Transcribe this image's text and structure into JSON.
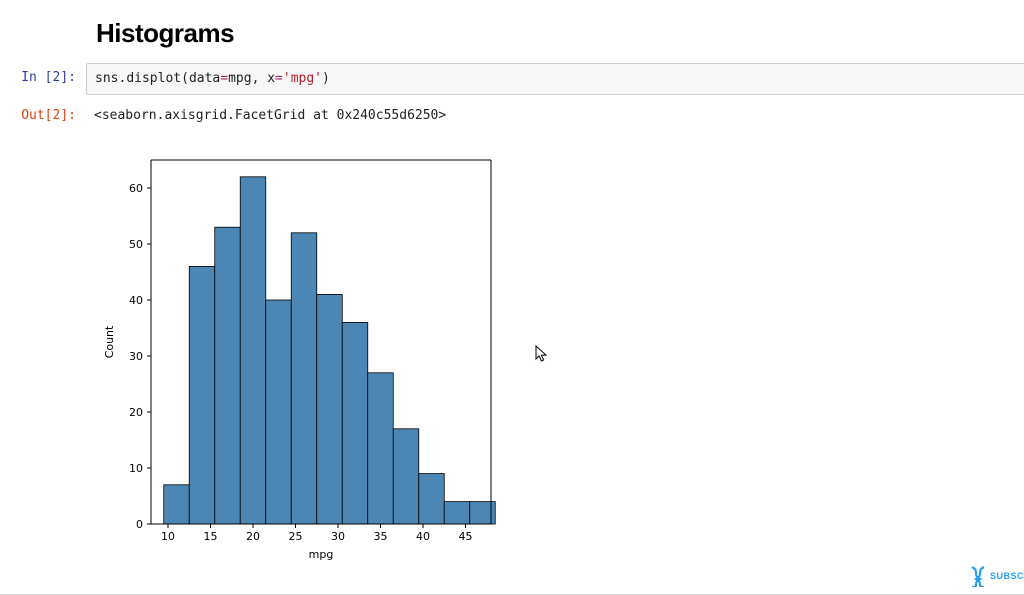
{
  "heading": "Histograms",
  "input_cell": {
    "prompt": "In [2]:",
    "code_tokens": [
      {
        "t": "sns",
        "c": "tok-ident"
      },
      {
        "t": ".",
        "c": "tok-punc"
      },
      {
        "t": "displot",
        "c": "tok-ident"
      },
      {
        "t": "(",
        "c": "tok-punc"
      },
      {
        "t": "data",
        "c": "tok-ident"
      },
      {
        "t": "=",
        "c": "tok-op"
      },
      {
        "t": "mpg",
        "c": "tok-ident"
      },
      {
        "t": ", ",
        "c": "tok-punc"
      },
      {
        "t": "x",
        "c": "tok-ident"
      },
      {
        "t": "=",
        "c": "tok-op"
      },
      {
        "t": "'mpg'",
        "c": "tok-str"
      },
      {
        "t": ")",
        "c": "tok-punc"
      }
    ]
  },
  "output_cell": {
    "prompt": "Out[2]:",
    "text": "<seaborn.axisgrid.FacetGrid at 0x240c55d6250>"
  },
  "watermark": "SUBSC",
  "chart_data": {
    "type": "bar",
    "title": "",
    "xlabel": "mpg",
    "ylabel": "Count",
    "xlim": [
      8,
      48
    ],
    "ylim": [
      0,
      65
    ],
    "xticks": [
      10,
      15,
      20,
      25,
      30,
      35,
      40,
      45
    ],
    "yticks": [
      0,
      10,
      20,
      30,
      40,
      50,
      60
    ],
    "bin_width": 3,
    "bin_left_edges": [
      9.5,
      12.5,
      15.5,
      18.5,
      21.5,
      24.5,
      27.5,
      30.5,
      33.5,
      36.5,
      39.5,
      42.5,
      45.5
    ],
    "values": [
      7,
      46,
      53,
      62,
      40,
      52,
      41,
      36,
      27,
      17,
      9,
      4,
      4
    ]
  }
}
